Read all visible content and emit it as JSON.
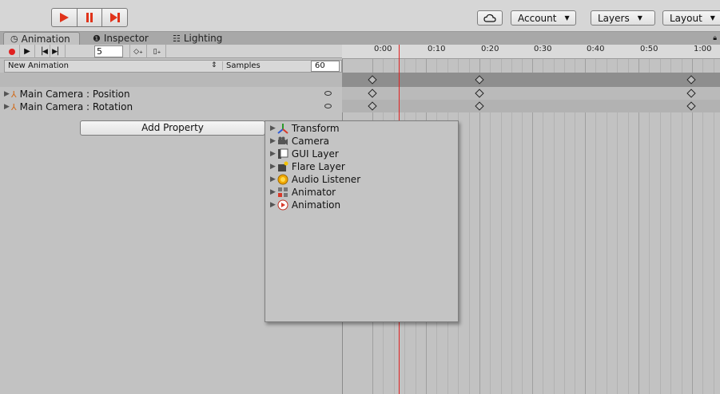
{
  "toolbar": {
    "play_icon": "play-icon",
    "pause_icon": "pause-icon",
    "step_icon": "step-icon",
    "cloud_icon": "cloud-icon",
    "account_label": "Account",
    "layers_label": "Layers",
    "layout_label": "Layout",
    "accent": "#e0331a"
  },
  "tabs": [
    {
      "label": "Animation",
      "icon": "clock-icon"
    },
    {
      "label": "Inspector",
      "icon": "info-icon"
    },
    {
      "label": "Lighting",
      "icon": "lighting-icon"
    }
  ],
  "anim_controls": {
    "frame": "5"
  },
  "clip": {
    "name": "New Animation",
    "samples_label": "Samples",
    "samples_value": "60"
  },
  "properties": [
    {
      "label": "Main Camera : Position"
    },
    {
      "label": "Main Camera : Rotation"
    }
  ],
  "add_property_label": "Add Property",
  "timeline": {
    "ticks": [
      "0:00",
      "0:10",
      "0:20",
      "0:30",
      "0:40",
      "0:50",
      "1:00"
    ]
  },
  "dropdown": {
    "items": [
      {
        "label": "Transform",
        "icon": "transform-icon"
      },
      {
        "label": "Camera",
        "icon": "camera-icon"
      },
      {
        "label": "GUI Layer",
        "icon": "gui-layer-icon"
      },
      {
        "label": "Flare Layer",
        "icon": "flare-layer-icon"
      },
      {
        "label": "Audio Listener",
        "icon": "audio-listener-icon"
      },
      {
        "label": "Animator",
        "icon": "animator-icon"
      },
      {
        "label": "Animation",
        "icon": "animation-icon"
      }
    ]
  }
}
